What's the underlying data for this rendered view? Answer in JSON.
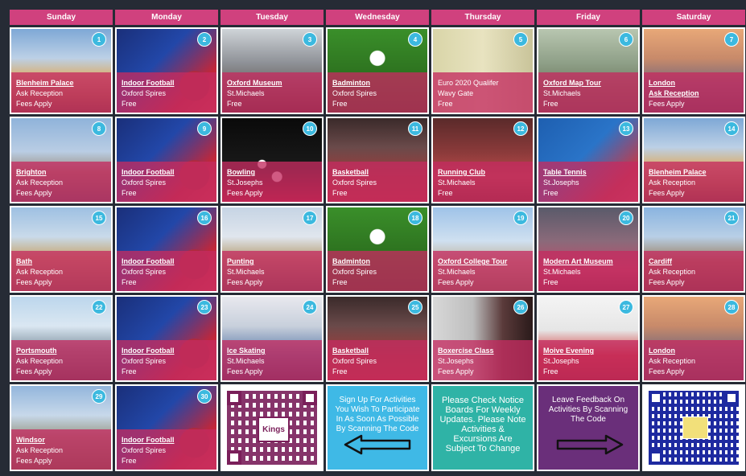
{
  "days": [
    "Sunday",
    "Monday",
    "Tuesday",
    "Wednesday",
    "Thursday",
    "Friday",
    "Saturday"
  ],
  "cells": [
    {
      "num": "1",
      "title": "Blenheim Palace",
      "sub": "Ask Reception",
      "fee": "Fees Apply",
      "theme": "palace",
      "name": "blenheim-palace"
    },
    {
      "num": "2",
      "title": "Indoor Football",
      "sub": "Oxford Spires",
      "fee": "Free",
      "theme": "football",
      "name": "indoor-football"
    },
    {
      "num": "3",
      "title": "Oxford Museum",
      "sub": "St.Michaels",
      "fee": "Free",
      "theme": "museum",
      "name": "oxford-museum"
    },
    {
      "num": "4",
      "title": "Badminton",
      "sub": "Oxford Spires",
      "fee": "Free",
      "theme": "badminton",
      "name": "badminton"
    },
    {
      "num": "5",
      "title": "Euro 2020 Qualifer",
      "sub": "Wavy Gate",
      "fee": "Free",
      "theme": "euro",
      "name": "euro-2020-qualifier",
      "plain": true
    },
    {
      "num": "6",
      "title": "Oxford Map Tour",
      "sub": "St.Michaels",
      "fee": "Free",
      "theme": "map",
      "name": "oxford-map-tour"
    },
    {
      "num": "7",
      "title": "London",
      "title2": "Ask Reception",
      "sub": "",
      "fee": "Fees Apply",
      "theme": "london",
      "name": "london"
    },
    {
      "num": "8",
      "title": "Brighton",
      "sub": "Ask Reception",
      "fee": "Fees Apply",
      "theme": "brighton",
      "name": "brighton"
    },
    {
      "num": "9",
      "title": "Indoor Football",
      "sub": "Oxford Spires",
      "fee": "Free",
      "theme": "football",
      "name": "indoor-football"
    },
    {
      "num": "10",
      "title": "Bowling",
      "sub": "St.Josephs",
      "fee": "Fees Apply",
      "theme": "bowling",
      "name": "bowling"
    },
    {
      "num": "11",
      "title": "Basketball",
      "sub": "Oxford Spires",
      "fee": "Free",
      "theme": "basket",
      "name": "basketball"
    },
    {
      "num": "12",
      "title": "Running Club",
      "sub": "St.Michaels",
      "fee": "Free",
      "theme": "running",
      "name": "running-club"
    },
    {
      "num": "13",
      "title": "Table Tennis",
      "sub": "St.Josephs",
      "fee": "Free",
      "theme": "tennis",
      "name": "table-tennis"
    },
    {
      "num": "14",
      "title": "Blenheim Palace",
      "sub": "Ask Reception",
      "fee": "Fees Apply",
      "theme": "palace",
      "name": "blenheim-palace"
    },
    {
      "num": "15",
      "title": "Bath",
      "sub": "Ask Reception",
      "fee": "Fees Apply",
      "theme": "bath",
      "name": "bath"
    },
    {
      "num": "16",
      "title": "Indoor Football",
      "sub": "Oxford Spires",
      "fee": "Free",
      "theme": "football",
      "name": "indoor-football"
    },
    {
      "num": "17",
      "title": "Punting",
      "sub": "St.Michaels",
      "fee": "Fees Apply",
      "theme": "punting",
      "name": "punting"
    },
    {
      "num": "18",
      "title": "Badminton",
      "sub": "Oxford Spires",
      "fee": "Free",
      "theme": "badminton",
      "name": "badminton"
    },
    {
      "num": "19",
      "title": "Oxford College Tour",
      "sub": "St.Michaels",
      "fee": "Fees Apply",
      "theme": "college",
      "name": "oxford-college-tour"
    },
    {
      "num": "20",
      "title": "Modern Art Museum",
      "sub": "St.Michaels",
      "fee": "Free",
      "theme": "modern",
      "name": "modern-art-museum"
    },
    {
      "num": "21",
      "title": "Cardiff",
      "sub": "Ask Reception",
      "fee": "Fees Apply",
      "theme": "cardiff",
      "name": "cardiff"
    },
    {
      "num": "22",
      "title": "Portsmouth",
      "sub": "Ask Reception",
      "fee": "Fees Apply",
      "theme": "ports",
      "name": "portsmouth"
    },
    {
      "num": "23",
      "title": "Indoor Football",
      "sub": "Oxford Spires",
      "fee": "Free",
      "theme": "football",
      "name": "indoor-football"
    },
    {
      "num": "24",
      "title": "Ice Skating",
      "sub": "St.Michaels",
      "fee": "Fees Apply",
      "theme": "skate",
      "name": "ice-skating"
    },
    {
      "num": "25",
      "title": "Basketball",
      "sub": "Oxford Spires",
      "fee": "Free",
      "theme": "basket",
      "name": "basketball"
    },
    {
      "num": "26",
      "title": "Boxercise Class",
      "sub": "St.Josephs",
      "fee": "Fees Apply",
      "theme": "boxer",
      "name": "boxercise-class"
    },
    {
      "num": "27",
      "title": "Moive Evening",
      "sub": "St.Josephs",
      "fee": "Free",
      "theme": "movie",
      "name": "movie-evening"
    },
    {
      "num": "28",
      "title": "London",
      "sub": "Ask Reception",
      "fee": "Fees Apply",
      "theme": "london",
      "name": "london"
    },
    {
      "num": "29",
      "title": "Windsor",
      "sub": "Ask Reception",
      "fee": "Fees Apply",
      "theme": "windsor",
      "name": "windsor"
    },
    {
      "num": "30",
      "title": "Indoor Football",
      "sub": "Oxford Spires",
      "fee": "Free",
      "theme": "football",
      "name": "indoor-football"
    }
  ],
  "qr_left": {
    "logo": "Kings"
  },
  "signup_text": "Sign Up For Activities You Wish To Participate In As Soon As Possible By Scanning The Code",
  "notice_text": "Please Check Notice Boards For Weekly Updates. Please Note Activities & Excursions Are Subject To Change",
  "feedback_text": "Leave Feedback On Activities By Scanning The Code",
  "colors": {
    "header": "#d0417e",
    "overlay": "#c42c60",
    "badge": "#3cb9df",
    "signup": "#3fb9e6",
    "notice": "#2fb3a6",
    "feedback": "#6a2f7a"
  }
}
